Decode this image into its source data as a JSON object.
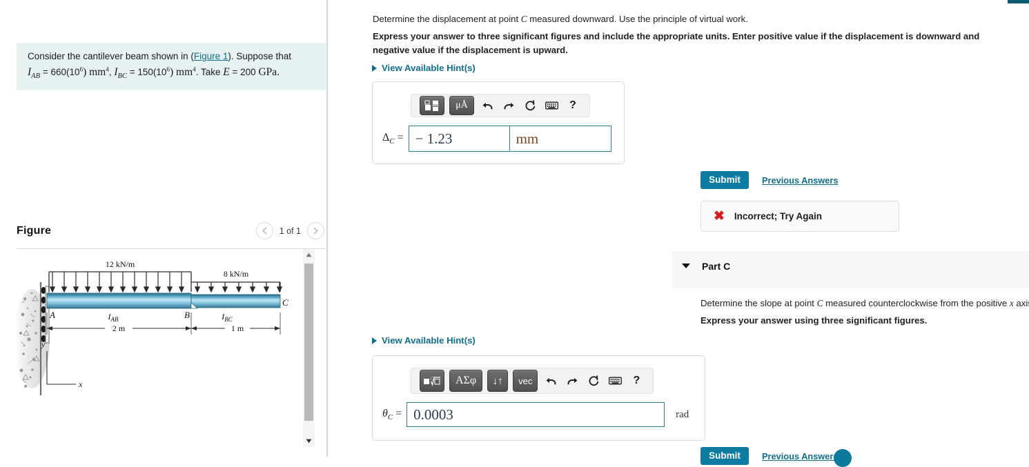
{
  "left_panel": {
    "problem_statement": {
      "lead": "Consider the cantilever beam shown in (",
      "figure_link": "Figure 1",
      "after_link": "). Suppose that",
      "i_ab_label": "I",
      "i_ab_sub": "AB",
      "i_ab_value": "= 660(10",
      "exp6": "6",
      "i_ab_units": ") mm",
      "exp4": "4",
      "comma": ", ",
      "i_bc_label": "I",
      "i_bc_sub": "BC",
      "i_bc_value": "= 150(10",
      "take": ". Take ",
      "e_label": "E",
      "e_value": "= 200 ",
      "e_units": "GPa."
    },
    "figure": {
      "title": "Figure",
      "pager_text": "1 of 1",
      "prev_icon": "chevron-left-icon",
      "next_icon": "chevron-right-icon",
      "scrollbar": {
        "up_icon": "triangle-up-icon",
        "down_icon": "triangle-down-icon"
      },
      "diagram": {
        "load_ab": "12 kN/m",
        "load_bc": "8 kN/m",
        "point_a": "A",
        "point_b": "B",
        "point_c": "C",
        "seg_ab_label": "I",
        "seg_ab_sub": "AB",
        "seg_bc_label": "I",
        "seg_bc_sub": "BC",
        "dim_ab": "2 m",
        "dim_bc": "1 m",
        "axis_y": "y",
        "axis_x": "x"
      }
    }
  },
  "right_panel": {
    "part_b": {
      "question": "Determine the displacement at point C measured downward. Use the principle of virtual work.",
      "question_pre": "Determine the displacement at point ",
      "question_var": "C",
      "question_post": " measured downward. Use the principle of virtual work.",
      "instruction": "Express your answer to three significant figures and include the appropriate units. Enter positive value if the displacement is downward and negative value if the displacement is upward.",
      "hints_label": "View Available Hint(s)",
      "toolbar": [
        {
          "name": "template-icon",
          "label": ""
        },
        {
          "name": "units-icon",
          "label": "μÅ"
        },
        {
          "name": "undo-icon",
          "label": ""
        },
        {
          "name": "redo-icon",
          "label": ""
        },
        {
          "name": "reset-icon",
          "label": ""
        },
        {
          "name": "keyboard-icon",
          "label": ""
        },
        {
          "name": "help-icon",
          "label": "?"
        }
      ],
      "answer_label_base": "Δ",
      "answer_label_sub": "C",
      "answer_eq": "=",
      "answer_value": "− 1.23",
      "answer_units": "mm",
      "submit_label": "Submit",
      "previous_answers_label": "Previous Answers",
      "feedback_icon": "x-mark-icon",
      "feedback_text": "Incorrect; Try Again"
    },
    "part_c": {
      "header": "Part C",
      "caret_icon": "caret-down-icon",
      "question_pre": "Determine the slope at point ",
      "question_var": "C",
      "question_mid": " measured counterclockwise from the positive ",
      "question_var2": "x",
      "question_post": " axis. Use the principle of virtual work.",
      "instruction": "Express your answer using three significant figures.",
      "hints_label": "View Available Hint(s)",
      "toolbar": [
        {
          "name": "radical-template-icon",
          "label": ""
        },
        {
          "name": "greek-symbols-icon",
          "label": "ΑΣφ"
        },
        {
          "name": "arrows-icon",
          "label": "↓↑"
        },
        {
          "name": "vector-icon",
          "label": "vec"
        },
        {
          "name": "undo-icon",
          "label": ""
        },
        {
          "name": "redo-icon",
          "label": ""
        },
        {
          "name": "reset-icon",
          "label": ""
        },
        {
          "name": "keyboard-icon",
          "label": ""
        },
        {
          "name": "help-icon",
          "label": "?"
        }
      ],
      "answer_label_base": "θ",
      "answer_label_sub": "C",
      "answer_eq": "=",
      "answer_value": "0.0003",
      "answer_units": "rad",
      "submit_label": "Submit",
      "previous_answers_label": "Previous Answers"
    }
  },
  "colors": {
    "accent_teal": "#0e7ba0",
    "link_teal": "#0f6e8c",
    "problem_bg": "#e7f3f3",
    "error_red": "#d81c1c",
    "band_gray": "#f7f7f7",
    "field_border": "#2a7e95"
  }
}
